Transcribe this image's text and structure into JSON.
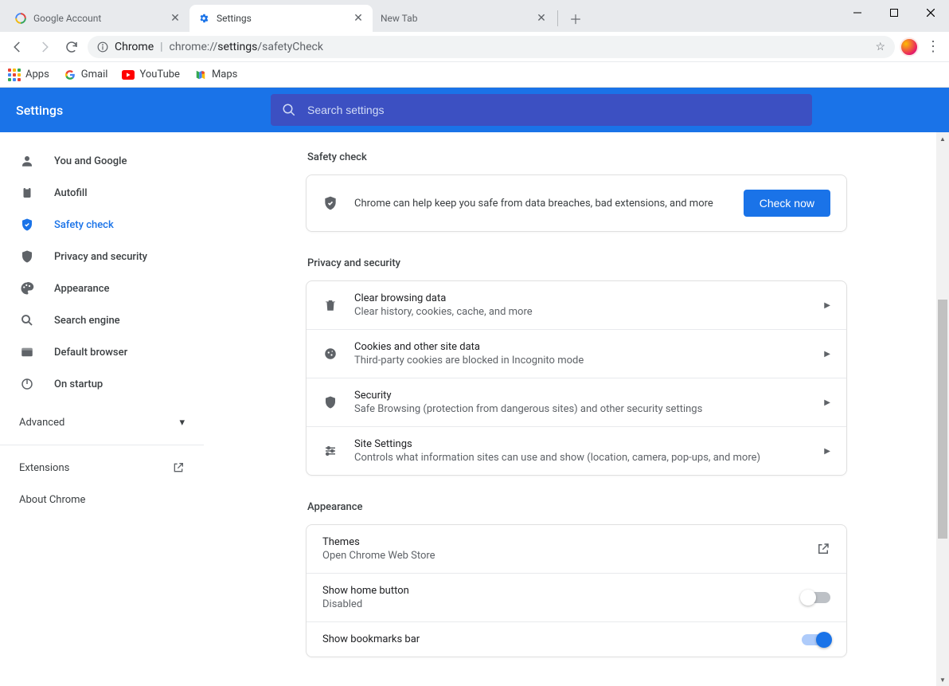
{
  "window": {
    "tabs": [
      {
        "title": "Google Account"
      },
      {
        "title": "Settings"
      },
      {
        "title": "New Tab"
      }
    ]
  },
  "omnibox": {
    "site_label": "Chrome",
    "url_prefix": "chrome://",
    "url_mid": "settings",
    "url_suffix": "/safetyCheck"
  },
  "bookmarks": {
    "apps": "Apps",
    "gmail": "Gmail",
    "youtube": "YouTube",
    "maps": "Maps"
  },
  "header": {
    "title": "Settings",
    "search_placeholder": "Search settings"
  },
  "sidebar": {
    "items": [
      {
        "label": "You and Google"
      },
      {
        "label": "Autofill"
      },
      {
        "label": "Safety check"
      },
      {
        "label": "Privacy and security"
      },
      {
        "label": "Appearance"
      },
      {
        "label": "Search engine"
      },
      {
        "label": "Default browser"
      },
      {
        "label": "On startup"
      }
    ],
    "advanced": "Advanced",
    "extensions": "Extensions",
    "about": "About Chrome"
  },
  "sections": {
    "safety": {
      "title": "Safety check",
      "desc": "Chrome can help keep you safe from data breaches, bad extensions, and more",
      "button": "Check now"
    },
    "privacy": {
      "title": "Privacy and security",
      "rows": [
        {
          "title": "Clear browsing data",
          "sub": "Clear history, cookies, cache, and more"
        },
        {
          "title": "Cookies and other site data",
          "sub": "Third-party cookies are blocked in Incognito mode"
        },
        {
          "title": "Security",
          "sub": "Safe Browsing (protection from dangerous sites) and other security settings"
        },
        {
          "title": "Site Settings",
          "sub": "Controls what information sites can use and show (location, camera, pop-ups, and more)"
        }
      ]
    },
    "appearance": {
      "title": "Appearance",
      "themes_title": "Themes",
      "themes_sub": "Open Chrome Web Store",
      "home_title": "Show home button",
      "home_sub": "Disabled",
      "bookmarks_title": "Show bookmarks bar"
    }
  }
}
